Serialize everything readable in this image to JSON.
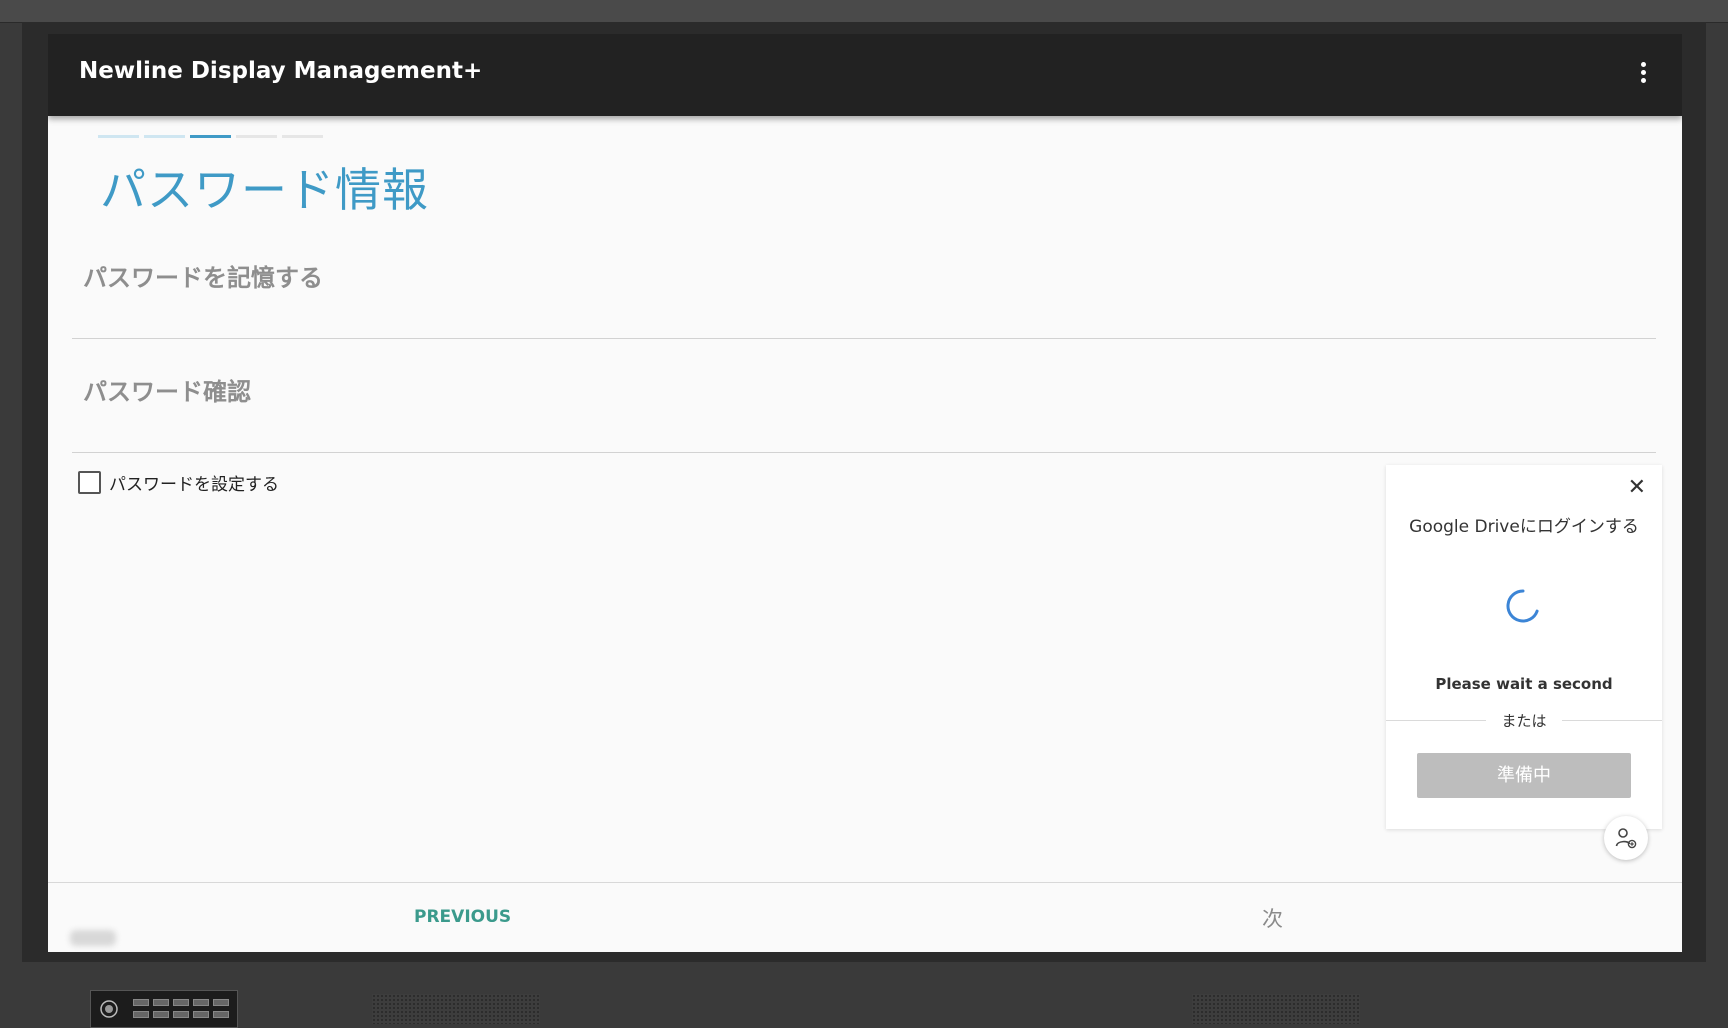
{
  "app": {
    "title": "Newline Display Management+",
    "menu_icon": "more-vertical-icon"
  },
  "wizard": {
    "steps": [
      {
        "state": "done",
        "color": "#cfe6f1"
      },
      {
        "state": "done",
        "color": "#cfe6f1"
      },
      {
        "state": "current",
        "color": "#3f9ac6"
      },
      {
        "state": "upcoming",
        "color": "#e6e6e6"
      },
      {
        "state": "upcoming",
        "color": "#e6e6e6"
      }
    ],
    "heading": "パスワード情報"
  },
  "form": {
    "remember_password_placeholder": "パスワードを記憶する",
    "confirm_password_placeholder": "パスワード確認",
    "set_password_checkbox_label": "パスワードを設定する",
    "set_password_checked": false
  },
  "footer": {
    "previous_label": "PREVIOUS",
    "next_label": "次"
  },
  "login_popup": {
    "title": "Google Driveにログインする",
    "status": "Please wait a second",
    "or_label": "または",
    "preparing_button": "準備中",
    "close_icon": "close-icon",
    "spinner_color": "#3c85d6"
  },
  "fab": {
    "icon": "user-add-icon"
  },
  "colors": {
    "accent": "#3f9ac6",
    "appbar": "#222222",
    "previous_button": "#3b9a8c"
  }
}
